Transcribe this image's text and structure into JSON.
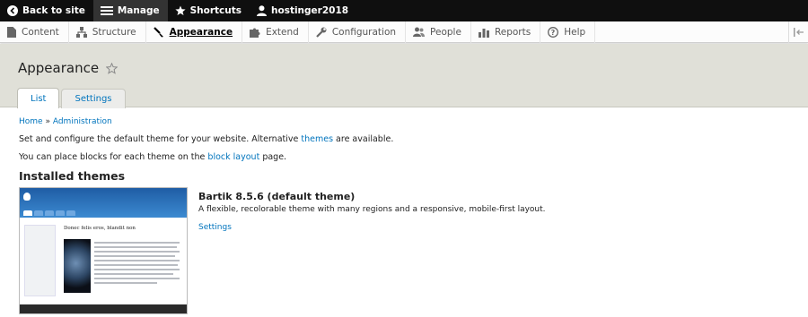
{
  "toolbar": {
    "back": "Back to site",
    "manage": "Manage",
    "shortcuts": "Shortcuts",
    "user": "hostinger2018"
  },
  "tray": {
    "items": [
      "Content",
      "Structure",
      "Appearance",
      "Extend",
      "Configuration",
      "People",
      "Reports",
      "Help"
    ],
    "active_index": 2
  },
  "page": {
    "title": "Appearance",
    "tabs": [
      "List",
      "Settings"
    ],
    "active_tab": "List"
  },
  "breadcrumb": [
    "Home",
    "Administration"
  ],
  "intro": {
    "line1_before": "Set and configure the default theme for your website. Alternative ",
    "line1_link": "themes",
    "line1_after": " are available.",
    "line2_before": "You can place blocks for each theme on the ",
    "line2_link": "block layout",
    "line2_after": " page."
  },
  "installed_heading": "Installed themes",
  "theme": {
    "name": "Bartik 8.5.6 (default theme)",
    "description": "A flexible, recolorable theme with many regions and a responsive, mobile-first layout.",
    "settings_link": "Settings",
    "screenshot_title": "Donec felis eros, blandit non"
  },
  "colors": {
    "toolbar_bg": "#0f0f0f",
    "link": "#0074bd",
    "header_bg": "#e0e0d8"
  }
}
